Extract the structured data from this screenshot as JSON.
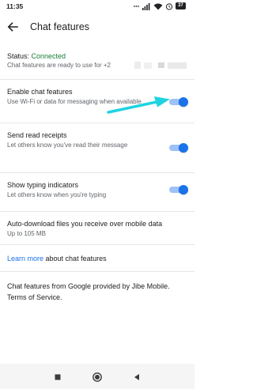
{
  "status_bar": {
    "time": "11:35",
    "battery": "37",
    "icons": [
      "dots-icon",
      "cell-signal-icon",
      "wifi-icon",
      "alarm-icon",
      "battery-icon"
    ]
  },
  "header": {
    "title": "Chat features",
    "back_icon": "back-arrow-icon"
  },
  "status": {
    "label": "Status: ",
    "value": "Connected",
    "subtext": "Chat features are ready to use for +2"
  },
  "settings": [
    {
      "title": "Enable chat features",
      "subtitle": "Use Wi-Fi or data for messaging when available",
      "enabled": true
    },
    {
      "title": "Send read receipts",
      "subtitle": "Let others know you've read their message",
      "enabled": true
    },
    {
      "title": "Show typing indicators",
      "subtitle": "Let others know when you're typing",
      "enabled": true
    },
    {
      "title": "Auto-download files you receive over mobile data",
      "subtitle": "Up to 105 MB"
    }
  ],
  "learn_more": {
    "link": "Learn more",
    "rest": " about chat features"
  },
  "footer": "Chat features from Google provided by Jibe Mobile. Terms of Service.",
  "colors": {
    "accent": "#1a73e8",
    "connected": "#188038",
    "annotation_arrow": "#1fd3e0"
  },
  "nav": [
    "stop-square-icon",
    "home-circle-icon",
    "back-triangle-icon"
  ]
}
